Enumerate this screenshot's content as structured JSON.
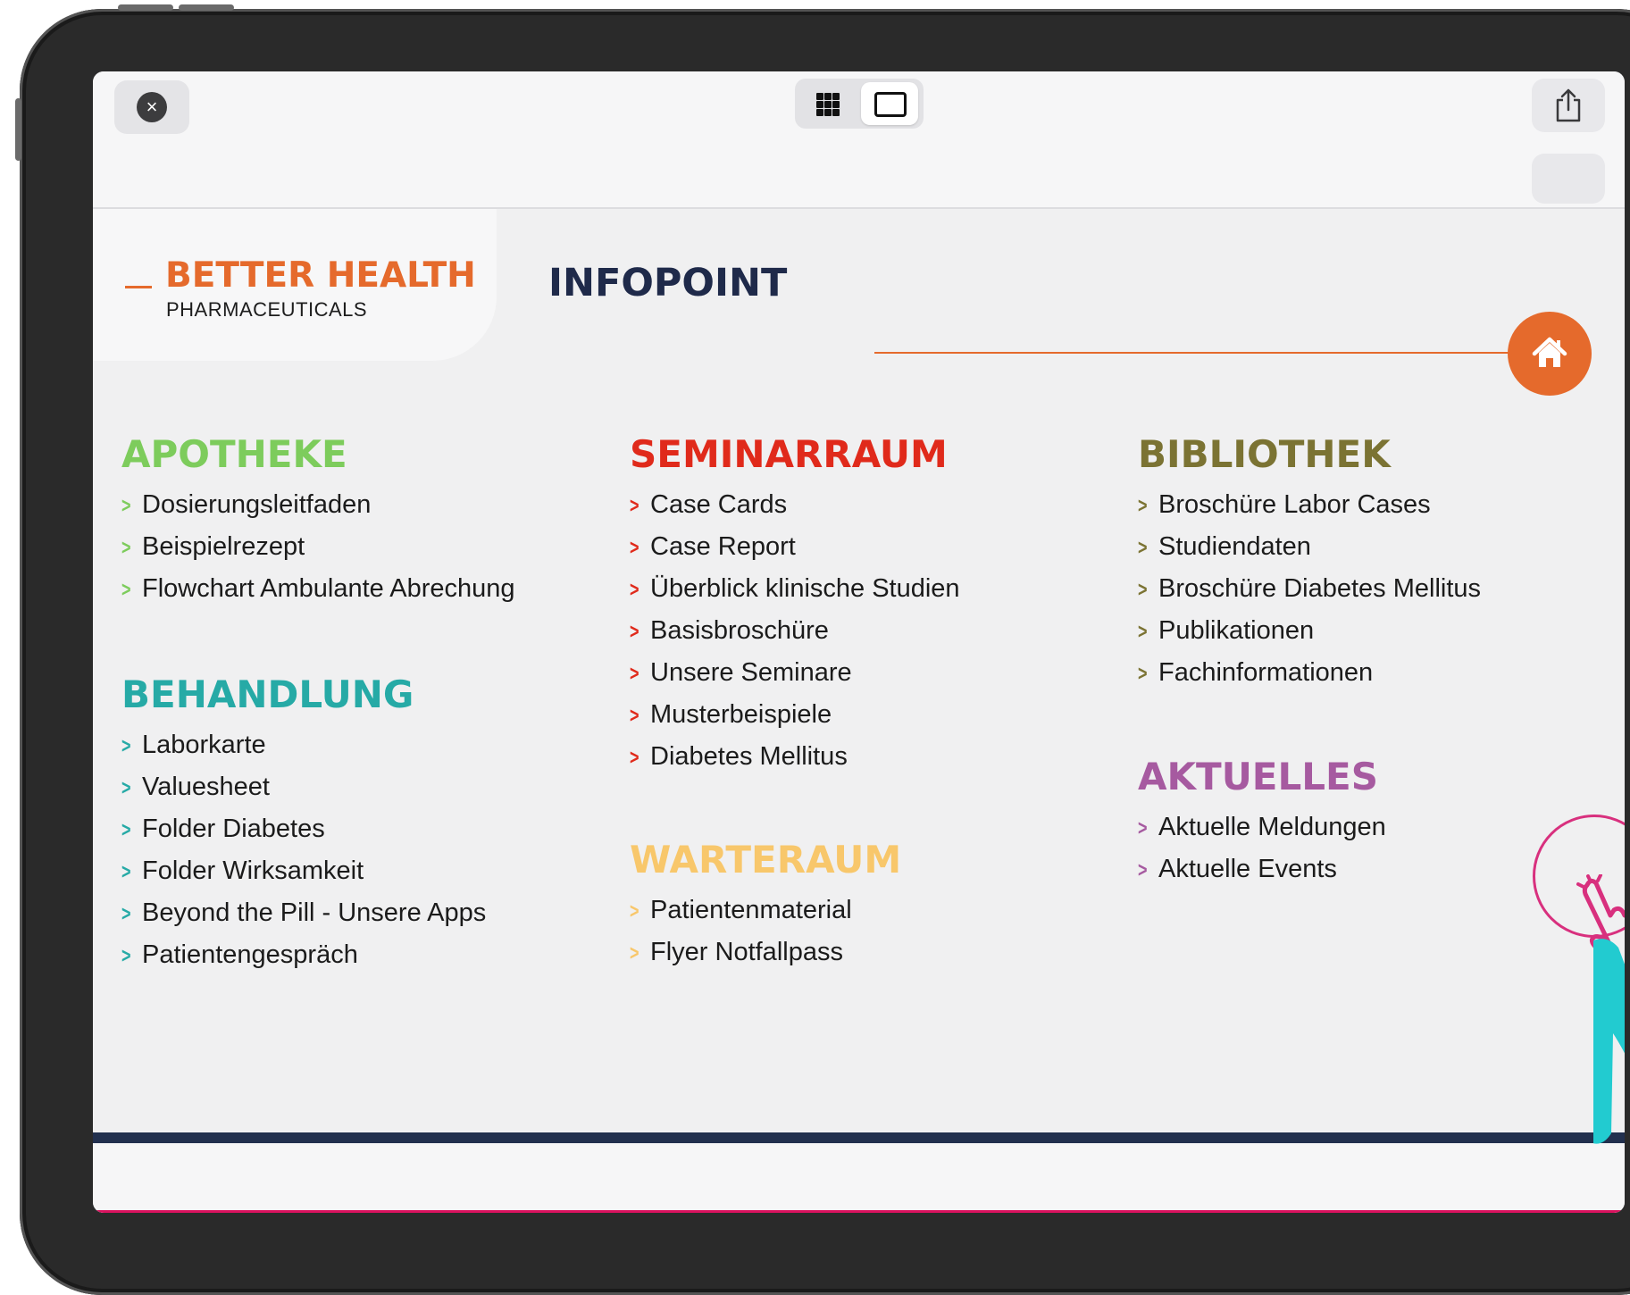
{
  "browser": {
    "close_glyph": "×"
  },
  "header": {
    "logo_main": "BETTER HEALTH",
    "logo_sub": "PHARMACEUTICALS",
    "title": "INFOPOINT"
  },
  "sections": {
    "apotheke": {
      "title": "APOTHEKE",
      "color": "#7dcc5c",
      "items": [
        "Dosierungsleitfaden",
        "Beispielrezept",
        "Flowchart Ambulante Abrechung"
      ]
    },
    "behandlung": {
      "title": "BEHANDLUNG",
      "color": "#26aaa6",
      "items": [
        "Laborkarte",
        "Valuesheet",
        "Folder Diabetes",
        "Folder Wirksamkeit",
        "Beyond the Pill - Unsere Apps",
        "Patientengespräch"
      ]
    },
    "seminarraum": {
      "title": "SEMINARRAUM",
      "color": "#e02a1b",
      "items": [
        "Case Cards",
        "Case Report",
        "Überblick klinische Studien",
        "Basisbroschüre",
        "Unsere Seminare",
        "Musterbeispiele",
        "Diabetes Mellitus"
      ]
    },
    "warteraum": {
      "title": "WARTERAUM",
      "color": "#f8c76b",
      "items": [
        "Patientenmaterial",
        "Flyer Notfallpass"
      ]
    },
    "bibliothek": {
      "title": "BIBLIOTHEK",
      "color": "#7b7333",
      "items": [
        "Broschüre Labor Cases",
        "Studiendaten",
        "Broschüre Diabetes Mellitus",
        "Publikationen",
        "Fachinformationen"
      ]
    },
    "aktuelles": {
      "title": "AKTUELLES",
      "color": "#a65aa0",
      "items": [
        "Aktuelle Meldungen",
        "Aktuelle Events"
      ]
    }
  },
  "colors": {
    "brand_orange": "#e56a2c",
    "navy": "#1f2a4a",
    "tap_indicator": "#d8307e",
    "arrow_teal": "#22cbd0"
  },
  "icons": {
    "close": "close-icon",
    "grid_view": "grid-view-icon",
    "single_view": "single-page-icon",
    "share": "share-icon",
    "home": "home-icon",
    "chevron": "chevron-right-icon",
    "tap": "hand-pointer-icon",
    "arrow": "arrow-icon"
  }
}
